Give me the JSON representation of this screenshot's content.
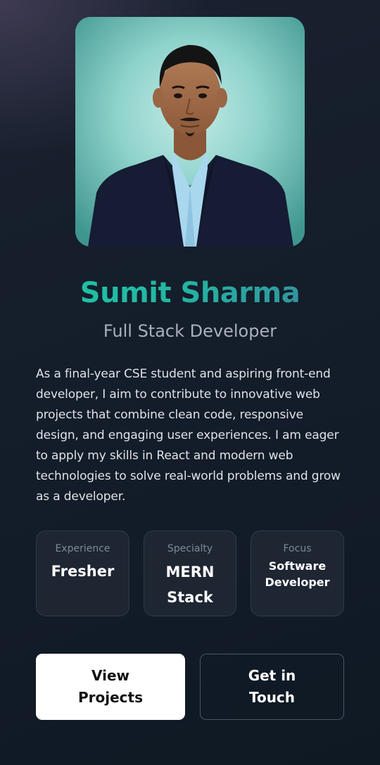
{
  "profile": {
    "name": "Sumit Sharma",
    "role": "Full Stack Developer",
    "bio": "As a final-year CSE student and aspiring front-end developer, I aim to contribute to innovative web projects that combine clean code, responsive design, and engaging user experiences. I am eager to apply my skills in React and modern web technologies to solve real-world problems and grow as a developer."
  },
  "stats": [
    {
      "label": "Experience",
      "value": "Fresher"
    },
    {
      "label": "Specialty",
      "value": "MERN Stack"
    },
    {
      "label": "Focus",
      "value": "Software Developer"
    }
  ],
  "actions": {
    "view_projects": "View Projects",
    "get_in_touch": "Get in Touch"
  },
  "colors": {
    "name_gradient_start": "#1fc7a8",
    "name_gradient_end": "#3c7f9a",
    "background": "#141d2a",
    "primary_button": "#ffffff"
  }
}
